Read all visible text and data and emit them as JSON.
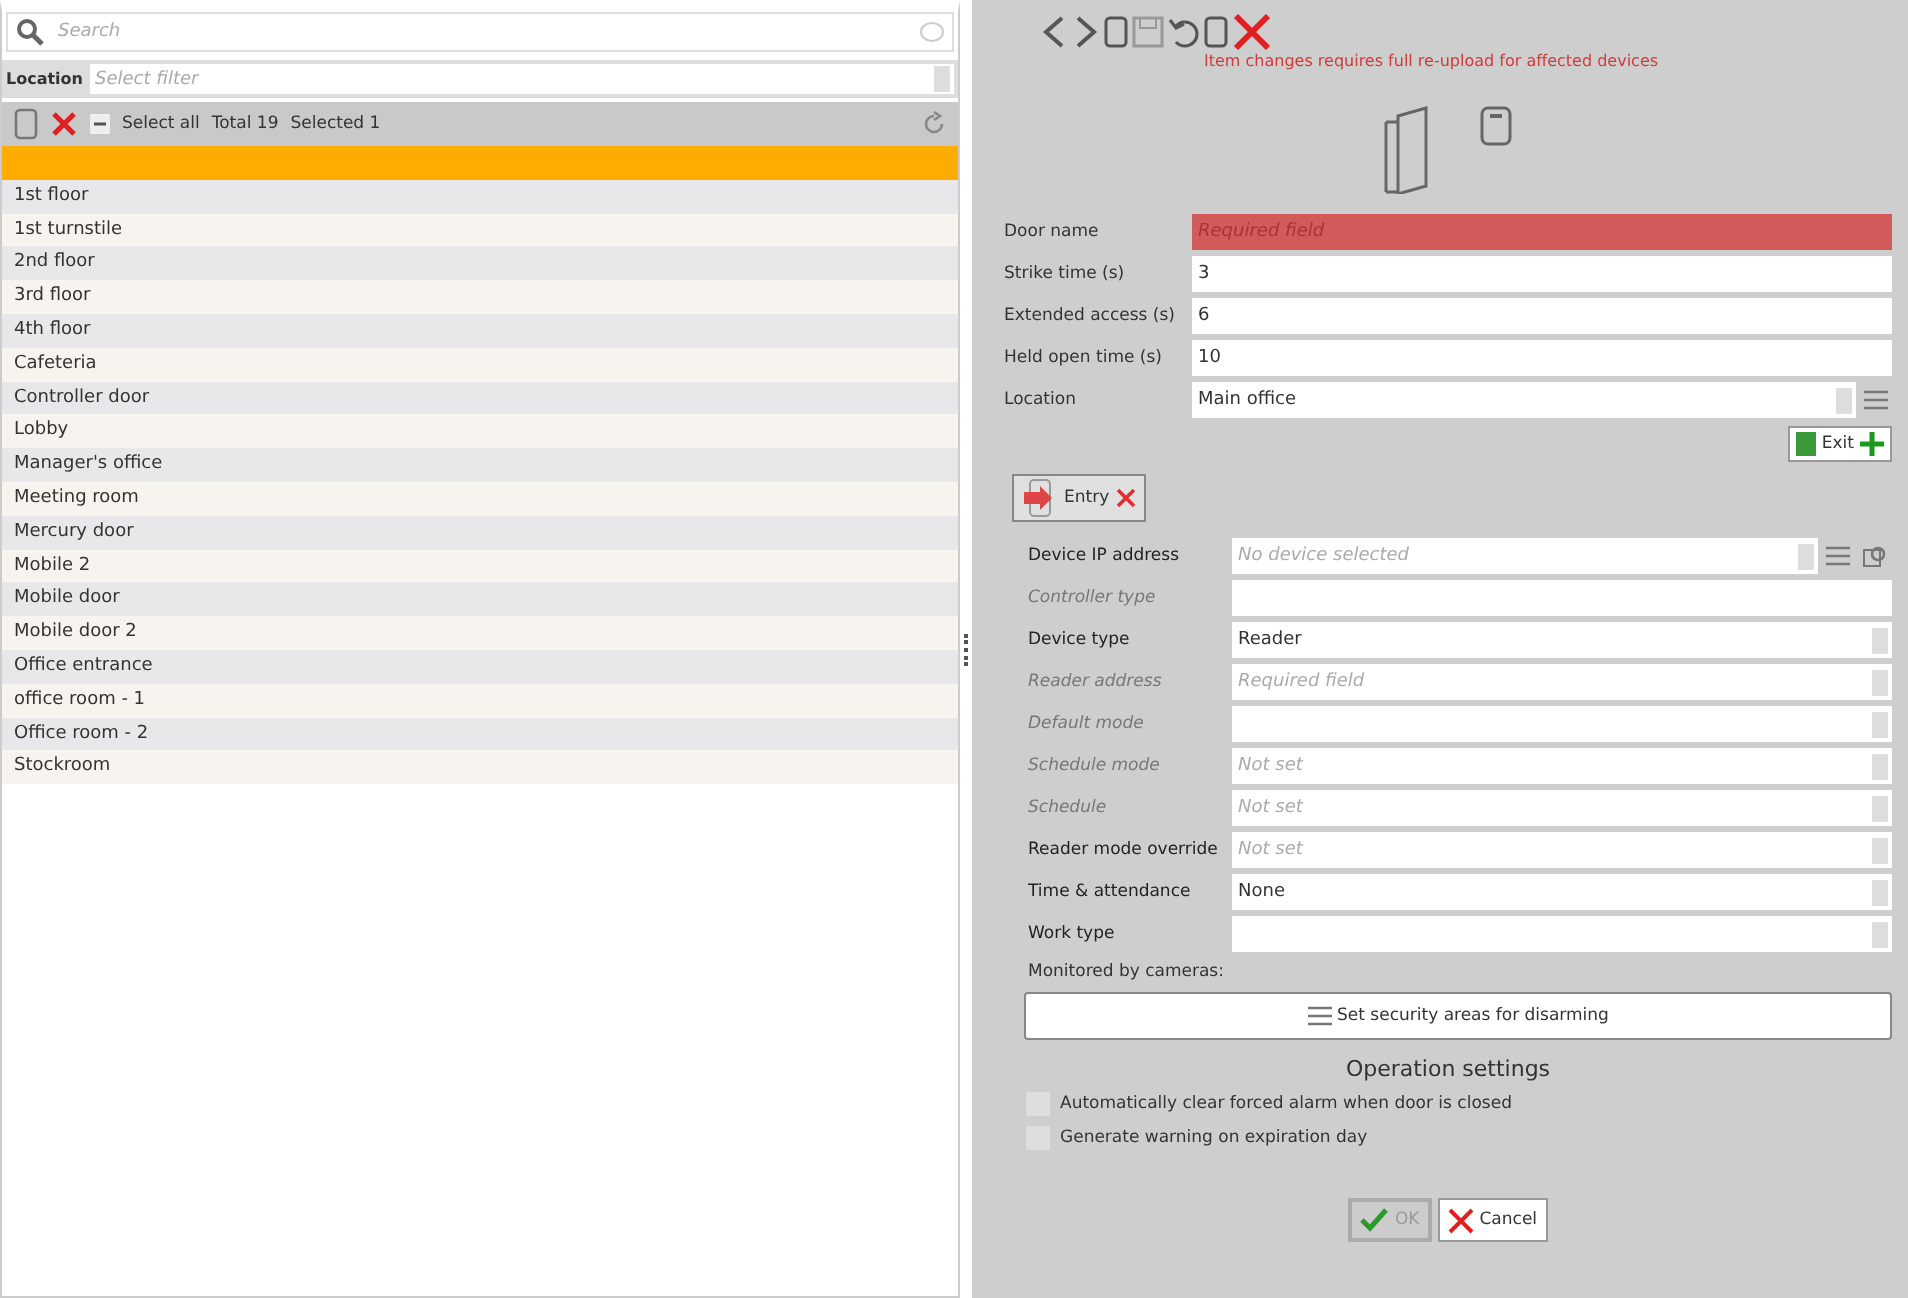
{
  "search": {
    "placeholder": "Search"
  },
  "filter": {
    "label": "Location",
    "placeholder": "Select filter"
  },
  "list_toolbar": {
    "select_all": "Select all",
    "total": "Total 19",
    "selected": "Selected 1"
  },
  "items": [
    {
      "selected": true
    },
    {
      "label": "1st floor",
      "selected": false
    },
    {
      "label": "1st turnstile",
      "selected": false
    },
    {
      "label": "2nd floor",
      "selected": false
    },
    {
      "label": "3rd floor",
      "selected": false
    },
    {
      "label": "4th floor",
      "selected": false
    },
    {
      "label": "Cafeteria",
      "selected": false
    },
    {
      "label": "Controller door",
      "selected": false
    },
    {
      "label": "Lobby",
      "selected": false
    },
    {
      "label": "Manager's office",
      "selected": false
    },
    {
      "label": "Meeting room",
      "selected": false
    },
    {
      "label": "Mercury door",
      "selected": false
    },
    {
      "label": "Mobile 2",
      "selected": false
    },
    {
      "label": "Mobile door",
      "selected": false
    },
    {
      "label": "Mobile door 2",
      "selected": false
    },
    {
      "label": "Office entrance",
      "selected": false
    },
    {
      "label": "office room - 1",
      "selected": false
    },
    {
      "label": "Office room - 2",
      "selected": false
    },
    {
      "label": "Stockroom",
      "selected": false
    }
  ],
  "warning": "Item changes requires full re-upload for affected devices",
  "door_fields": [
    {
      "label": "Door name",
      "placeholder": "Required field",
      "kind": "text",
      "required": true,
      "disabled": false
    },
    {
      "label": "Strike time (s)",
      "value": "3",
      "kind": "text",
      "required": false,
      "disabled": false
    },
    {
      "label": "Extended access (s)",
      "value": "6",
      "kind": "text",
      "required": false,
      "disabled": false
    },
    {
      "label": "Held open time (s)",
      "value": "10",
      "kind": "text",
      "required": false,
      "disabled": false
    },
    {
      "label": "Location",
      "value": "Main office",
      "kind": "list",
      "required": false,
      "disabled": false
    }
  ],
  "exit_button": "Exit",
  "entry_tab": {
    "label": "Entry",
    "selected": true
  },
  "device_fields": [
    {
      "label": "Device IP address",
      "placeholder": "No device selected",
      "kind": "device",
      "disabled": false
    },
    {
      "label": "Controller type",
      "kind": "text",
      "disabled": true
    },
    {
      "label": "Device type",
      "value": "Reader",
      "kind": "select",
      "disabled": false
    },
    {
      "label": "Reader address",
      "placeholder": "Required field",
      "kind": "select",
      "disabled": true
    },
    {
      "label": "Default mode",
      "kind": "select",
      "disabled": true
    },
    {
      "label": "Schedule mode",
      "placeholder": "Not set",
      "kind": "select",
      "disabled": true
    },
    {
      "label": "Schedule",
      "placeholder": "Not set",
      "kind": "select",
      "disabled": true
    },
    {
      "label": "Reader mode override",
      "placeholder": "Not set",
      "kind": "select",
      "disabled": false
    },
    {
      "label": "Time & attendance",
      "value": "None",
      "kind": "select",
      "disabled": false
    },
    {
      "label": "Work type",
      "kind": "select",
      "disabled": false
    }
  ],
  "monitored_label": "Monitored by cameras:",
  "security_button": "Set security areas for disarming",
  "section_title": "Operation settings",
  "options": [
    {
      "label": "Automatically clear forced alarm when door is closed",
      "checked": false
    },
    {
      "label": "Generate warning on expiration day",
      "checked": false
    }
  ],
  "ok_button": {
    "label": "OK",
    "disabled": true
  },
  "cancel_button": "Cancel"
}
